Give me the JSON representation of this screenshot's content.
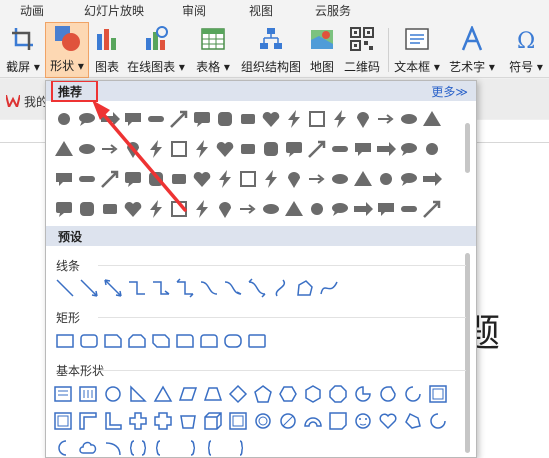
{
  "menu": {
    "tabs": [
      "动画",
      "幻灯片放映",
      "审阅",
      "视图",
      "云服务"
    ]
  },
  "ribbon": {
    "screenshot": "截屏",
    "shape": "形状",
    "chart": "图表",
    "online_chart": "在线图表",
    "table": "表格",
    "org_chart": "组织结构图",
    "map": "地图",
    "qrcode": "二维码",
    "textbox": "文本框",
    "wordart": "艺术字",
    "symbol": "符号",
    "dropdown_arrow": "▾"
  },
  "strip": {
    "label": "我的"
  },
  "document": {
    "title_fragment": "题"
  },
  "popup": {
    "recommended": "推荐",
    "more": "更多≫",
    "preset": "预设",
    "lines": "线条",
    "rectangles": "矩形",
    "basic_shapes": "基本形状"
  },
  "colors": {
    "accent_red": "#e33333",
    "shape_gray": "#6b6b6b",
    "outline_blue": "#3a6fc4",
    "section_header": "#dde3ee"
  }
}
